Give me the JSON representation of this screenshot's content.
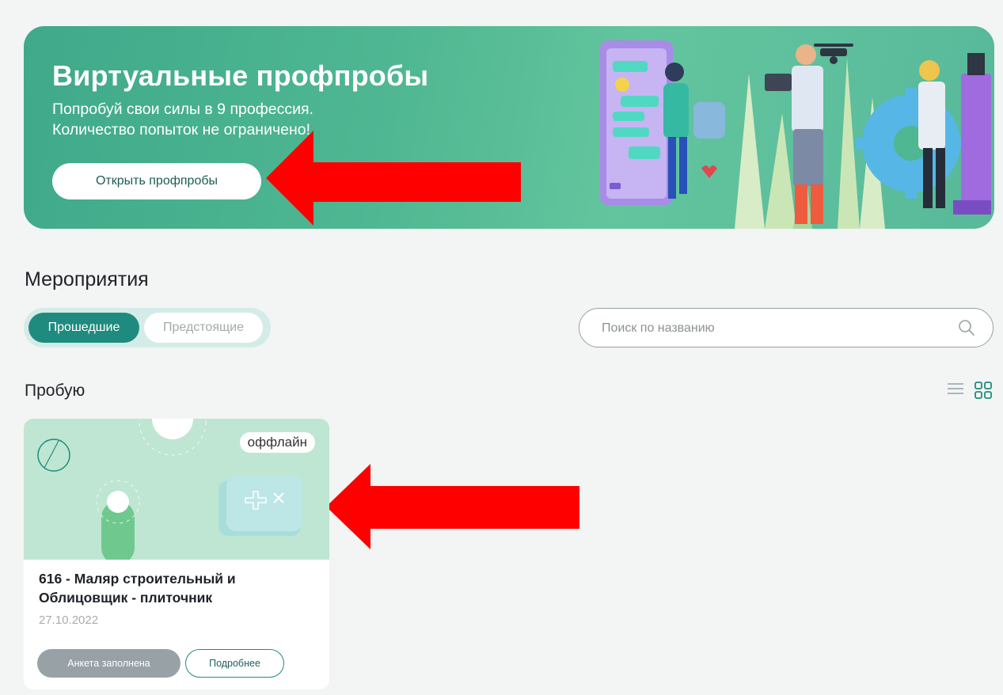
{
  "banner": {
    "title": "Виртуальные профпробы",
    "subtitle_line1": "Попробуй свои силы в 9 профессия.",
    "subtitle_line2": "Количество попыток не ограничено!",
    "button_label": "Открыть профпробы"
  },
  "events": {
    "title": "Мероприятия",
    "tabs": [
      {
        "label": "Прошедшие",
        "active": true
      },
      {
        "label": "Предстоящие",
        "active": false
      }
    ],
    "search": {
      "placeholder": "Поиск по названию",
      "value": ""
    }
  },
  "group": {
    "title": "Пробую"
  },
  "cards": [
    {
      "badge": "оффлайн",
      "title_line1": "616 - Маляр строительный и",
      "title_line2": "Облицовщик - плиточник",
      "date": "27.10.2022",
      "status_label": "Анкета заполнена",
      "details_label": "Подробнее"
    }
  ],
  "colors": {
    "accent": "#1f8b7e",
    "banner_green": "#4fb792",
    "arrow_red": "#ff0000",
    "status_grey": "#98a1a6"
  },
  "icons": [
    "search-icon",
    "list-view-icon",
    "grid-view-icon"
  ]
}
